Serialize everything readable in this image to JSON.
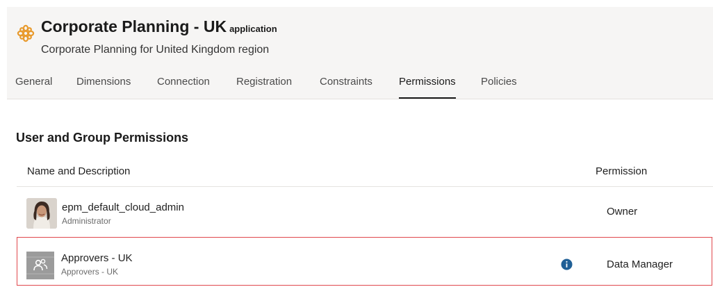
{
  "app": {
    "title": "Corporate Planning - UK",
    "title_tag": "application",
    "subtitle": "Corporate Planning for United Kingdom region",
    "icon": "gear-flower-icon",
    "accent": "#e89a2d"
  },
  "tabs": [
    {
      "label": "General",
      "active": false
    },
    {
      "label": "Dimensions",
      "active": false
    },
    {
      "label": "Connection",
      "active": false
    },
    {
      "label": "Registration",
      "active": false
    },
    {
      "label": "Constraints",
      "active": false
    },
    {
      "label": "Permissions",
      "active": true
    },
    {
      "label": "Policies",
      "active": false
    }
  ],
  "section": {
    "title": "User and Group Permissions"
  },
  "table": {
    "headers": {
      "name": "Name and Description",
      "permission": "Permission"
    },
    "rows": [
      {
        "name": "epm_default_cloud_admin",
        "description": "Administrator",
        "permission": "Owner",
        "avatar": "user-photo"
      },
      {
        "name": "Approvers - UK",
        "description": "Approvers - UK",
        "permission": "Data Manager",
        "avatar": "group-icon",
        "info_icon": "info-icon",
        "highlight_color": "#e0474c"
      }
    ]
  }
}
